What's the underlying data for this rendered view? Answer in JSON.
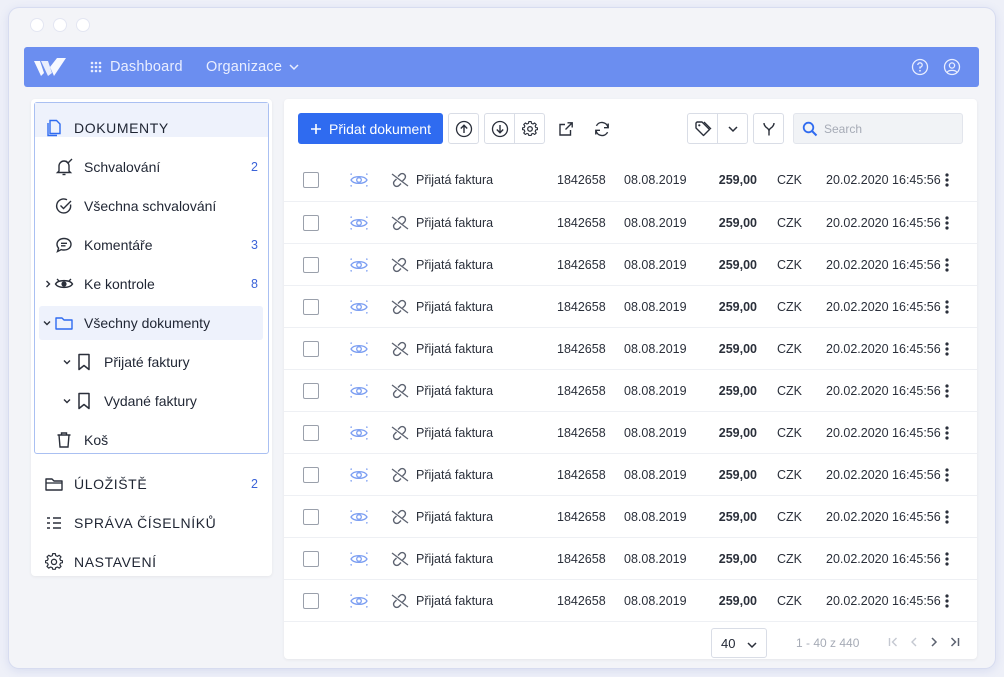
{
  "topbar": {
    "dashboard_label": "Dashboard",
    "organization_label": "Organizace",
    "accent": "#6b8ef0"
  },
  "sidebar": {
    "section_documents": "DOKUMENTY",
    "items": [
      {
        "label": "Schvalování",
        "count": "2",
        "icon": "bell-check-icon"
      },
      {
        "label": "Všechna schvalování",
        "count": "",
        "icon": "check-circle-icon"
      },
      {
        "label": "Komentáře",
        "count": "3",
        "icon": "comment-icon"
      },
      {
        "label": "Ke kontrole",
        "count": "8",
        "icon": "eye-icon"
      },
      {
        "label": "Všechny dokumenty",
        "count": "",
        "icon": "folder-icon",
        "active": true
      },
      {
        "label": "Přijaté faktury",
        "count": "",
        "icon": "bookmark-icon"
      },
      {
        "label": "Vydané faktury",
        "count": "",
        "icon": "bookmark-icon"
      },
      {
        "label": "Koš",
        "count": "",
        "icon": "trash-icon"
      }
    ],
    "section_storage": "ÚLOŽIŠTĚ",
    "section_storage_count": "2",
    "section_codelists": "SPRÁVA ČÍSELNÍKŮ",
    "section_settings": "NASTAVENÍ"
  },
  "toolbar": {
    "add_label": "Přidat dokument",
    "search_placeholder": "Search"
  },
  "table": {
    "rows": [
      {
        "type": "Přijatá faktura",
        "number": "1842658",
        "date": "08.08.2019",
        "amount": "259,00",
        "currency": "CZK",
        "timestamp": "20.02.2020 16:45:56"
      },
      {
        "type": "Přijatá faktura",
        "number": "1842658",
        "date": "08.08.2019",
        "amount": "259,00",
        "currency": "CZK",
        "timestamp": "20.02.2020 16:45:56"
      },
      {
        "type": "Přijatá faktura",
        "number": "1842658",
        "date": "08.08.2019",
        "amount": "259,00",
        "currency": "CZK",
        "timestamp": "20.02.2020 16:45:56"
      },
      {
        "type": "Přijatá faktura",
        "number": "1842658",
        "date": "08.08.2019",
        "amount": "259,00",
        "currency": "CZK",
        "timestamp": "20.02.2020 16:45:56"
      },
      {
        "type": "Přijatá faktura",
        "number": "1842658",
        "date": "08.08.2019",
        "amount": "259,00",
        "currency": "CZK",
        "timestamp": "20.02.2020 16:45:56"
      },
      {
        "type": "Přijatá faktura",
        "number": "1842658",
        "date": "08.08.2019",
        "amount": "259,00",
        "currency": "CZK",
        "timestamp": "20.02.2020 16:45:56"
      },
      {
        "type": "Přijatá faktura",
        "number": "1842658",
        "date": "08.08.2019",
        "amount": "259,00",
        "currency": "CZK",
        "timestamp": "20.02.2020 16:45:56"
      },
      {
        "type": "Přijatá faktura",
        "number": "1842658",
        "date": "08.08.2019",
        "amount": "259,00",
        "currency": "CZK",
        "timestamp": "20.02.2020 16:45:56"
      },
      {
        "type": "Přijatá faktura",
        "number": "1842658",
        "date": "08.08.2019",
        "amount": "259,00",
        "currency": "CZK",
        "timestamp": "20.02.2020 16:45:56"
      },
      {
        "type": "Přijatá faktura",
        "number": "1842658",
        "date": "08.08.2019",
        "amount": "259,00",
        "currency": "CZK",
        "timestamp": "20.02.2020 16:45:56"
      },
      {
        "type": "Přijatá faktura",
        "number": "1842658",
        "date": "08.08.2019",
        "amount": "259,00",
        "currency": "CZK",
        "timestamp": "20.02.2020 16:45:56"
      }
    ]
  },
  "pagination": {
    "page_size": "40",
    "range_label": "1 - 40 z 440"
  },
  "colors": {
    "primary": "#2f6bf0",
    "count": "#3b63d8",
    "eye": "#7b9ef2"
  }
}
